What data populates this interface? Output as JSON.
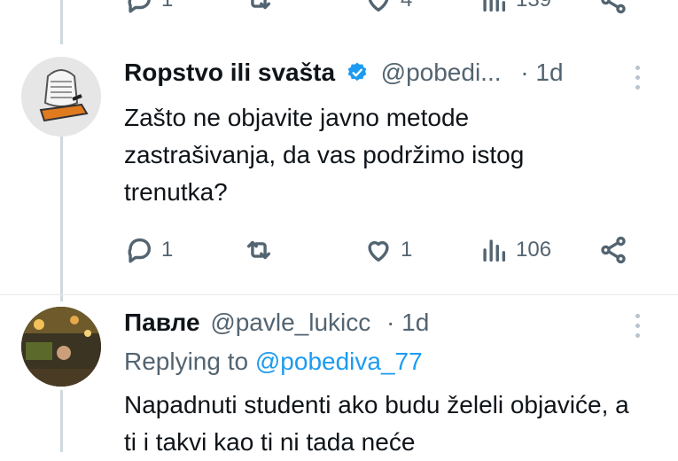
{
  "top_actions": {
    "replies": "1",
    "likes": "4",
    "views": "139"
  },
  "tweet1": {
    "display_name": "Ropstvo ili svašta",
    "handle": "@pobedi...",
    "separator": "·",
    "time": "1d",
    "text": "Zašto ne objavite javno metode zastrašivanja, da vas podržimo istog trenutka?",
    "replies": "1",
    "likes": "1",
    "views": "106"
  },
  "tweet2": {
    "display_name": "Павле",
    "handle": "@pavle_lukicc",
    "separator": "·",
    "time": "1d",
    "replying_prefix": "Replying to",
    "replying_handle": "@pobediva_77",
    "text": "Napadnuti studenti ako budu želeli objaviće, a ti i takvi kao ti ni tada neće"
  },
  "colors": {
    "link": "#1d9bf0",
    "muted": "#536471",
    "verified": "#1d9bf0",
    "thread_line": "#cfd9de"
  },
  "icons": [
    "reply-icon",
    "retweet-icon",
    "like-icon",
    "views-icon",
    "share-icon",
    "verified-badge-icon",
    "more-icon"
  ]
}
